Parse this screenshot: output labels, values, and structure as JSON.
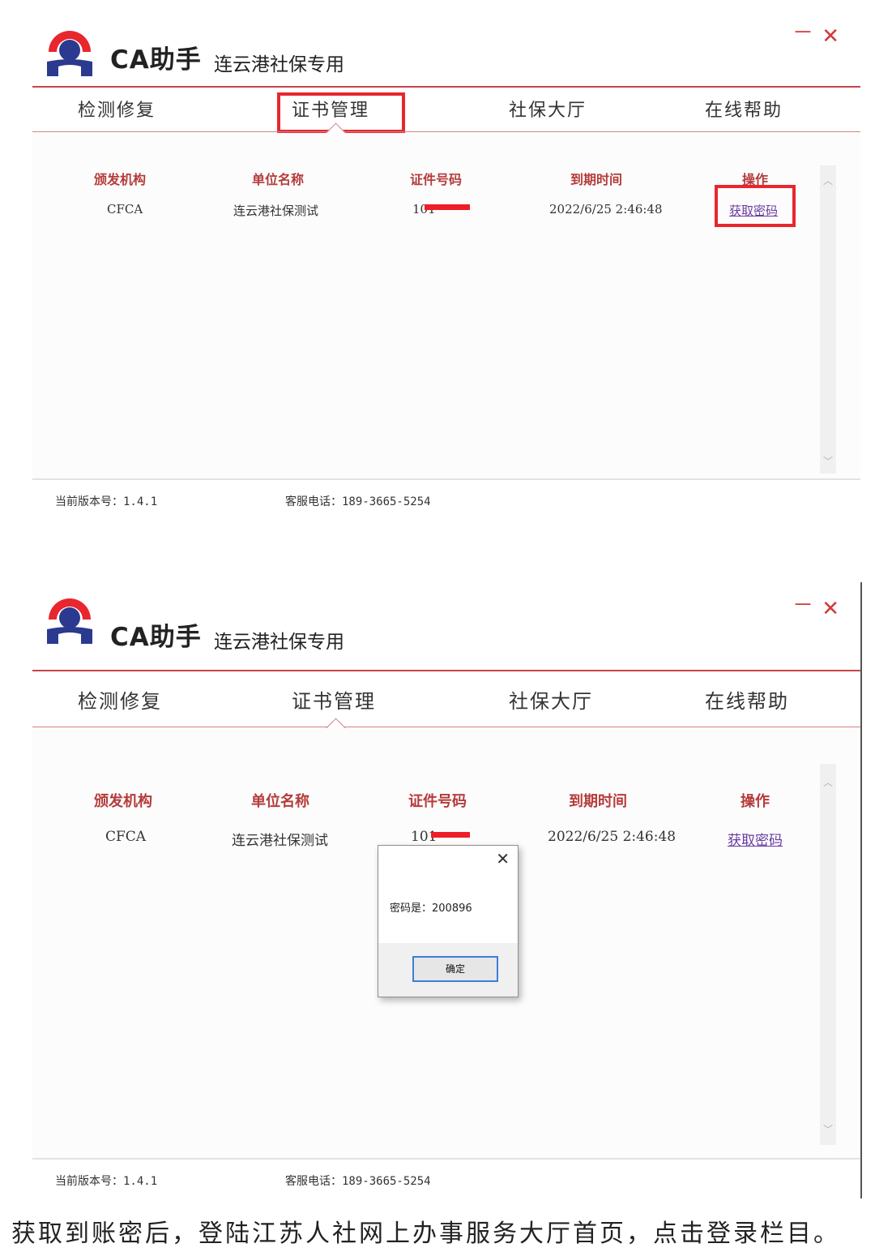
{
  "colors": {
    "accent_red": "#c7444b",
    "logo_red": "#e8262e",
    "logo_blue": "#2b3a8f",
    "link": "#6a3aa0",
    "header": "#b53b3b"
  },
  "app": {
    "title": "CA助手",
    "subtitle": "连云港社保专用",
    "minimize": "－",
    "close": "✕"
  },
  "tabs": [
    "检测修复",
    "证书管理",
    "社保大厅",
    "在线帮助"
  ],
  "table": {
    "headers": [
      "颁发机构",
      "单位名称",
      "证件号码",
      "到期时间",
      "操作"
    ],
    "row": {
      "issuer": "CFCA",
      "company": "连云港社保测试",
      "cert_no": "101",
      "expiry": "2022/6/25 2:46:48",
      "action": "获取密码"
    }
  },
  "scroll": {
    "up": "︿",
    "down": "﹀"
  },
  "footer": {
    "version": "当前版本号：1.4.1",
    "phone": "客服电话：189-3665-5254"
  },
  "dialog": {
    "message": "密码是：200896",
    "ok": "确定",
    "close": "✕"
  },
  "caption": "获取到账密后，登陆江苏人社网上办事服务大厅首页，点击登录栏目。"
}
